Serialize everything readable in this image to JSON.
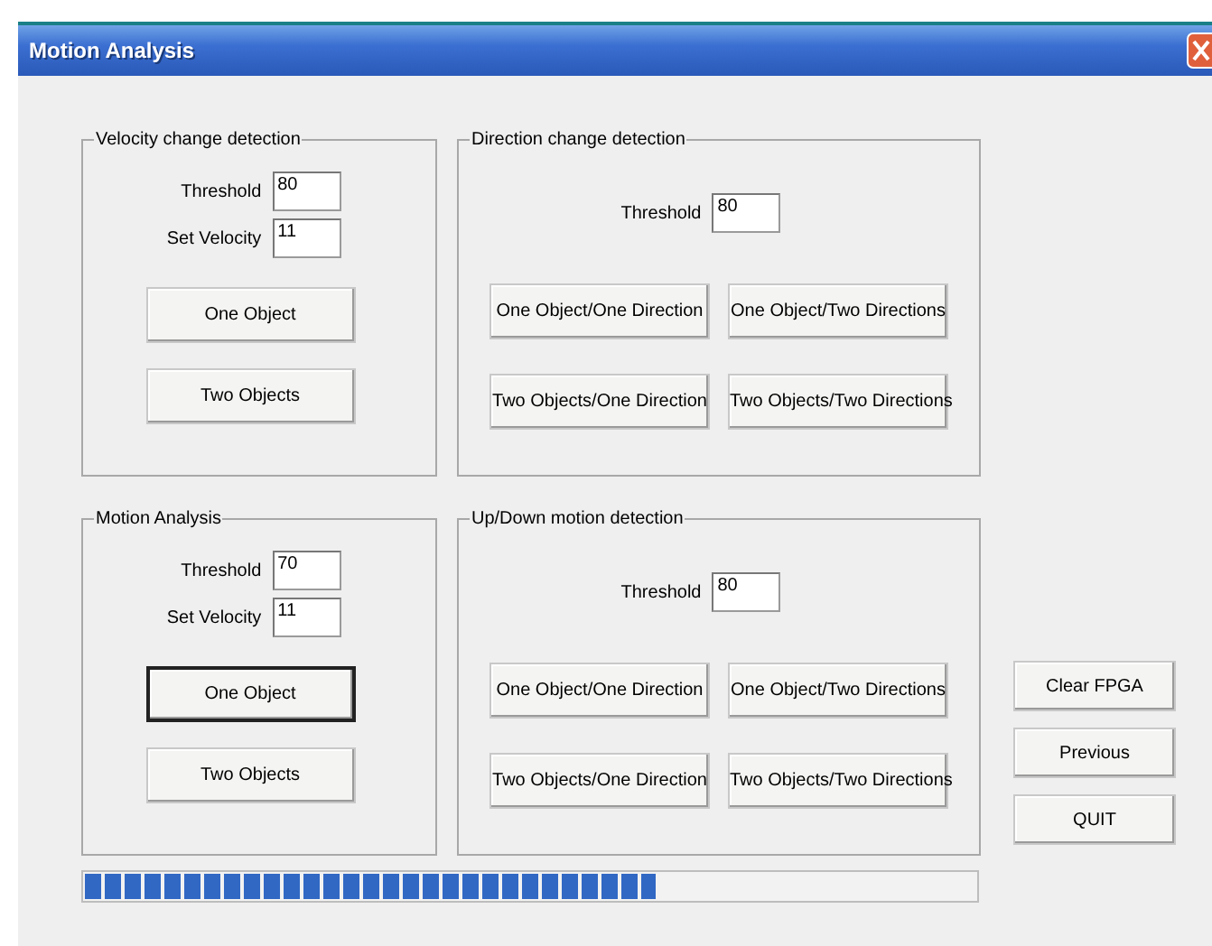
{
  "window": {
    "title": "Motion Analysis"
  },
  "groups": [
    {
      "kind": "stacked",
      "title": "Velocity change detection",
      "fields": [
        {
          "label": "Threshold",
          "value": "80"
        },
        {
          "label": "Set Velocity",
          "value": "11"
        }
      ],
      "buttons": [
        {
          "label": "One Object",
          "focused": false
        },
        {
          "label": "Two Objects",
          "focused": false
        }
      ]
    },
    {
      "kind": "grid",
      "title": "Direction change detection",
      "fields": [
        {
          "label": "Threshold",
          "value": "80"
        }
      ],
      "buttons": [
        {
          "label": "One Object/One Direction",
          "focused": false
        },
        {
          "label": "One Object/Two Directions",
          "focused": false
        },
        {
          "label": "Two Objects/One Direction",
          "focused": false
        },
        {
          "label": "Two Objects/Two Directions",
          "focused": false
        }
      ]
    },
    {
      "kind": "stacked",
      "title": "Motion Analysis",
      "fields": [
        {
          "label": "Threshold",
          "value": "70"
        },
        {
          "label": "Set Velocity",
          "value": "11"
        }
      ],
      "buttons": [
        {
          "label": "One Object",
          "focused": true
        },
        {
          "label": "Two Objects",
          "focused": false
        }
      ]
    },
    {
      "kind": "grid",
      "title": "Up/Down motion detection",
      "fields": [
        {
          "label": "Threshold",
          "value": "80"
        }
      ],
      "buttons": [
        {
          "label": "One Object/One Direction",
          "focused": false
        },
        {
          "label": "One Object/Two Directions",
          "focused": false
        },
        {
          "label": "Two Objects/One Direction",
          "focused": false
        },
        {
          "label": "Two Objects/Two Directions",
          "focused": false
        }
      ]
    }
  ],
  "progress": {
    "level": 0.64
  },
  "side_buttons": [
    "Clear FPGA",
    "Previous",
    "QUIT"
  ]
}
